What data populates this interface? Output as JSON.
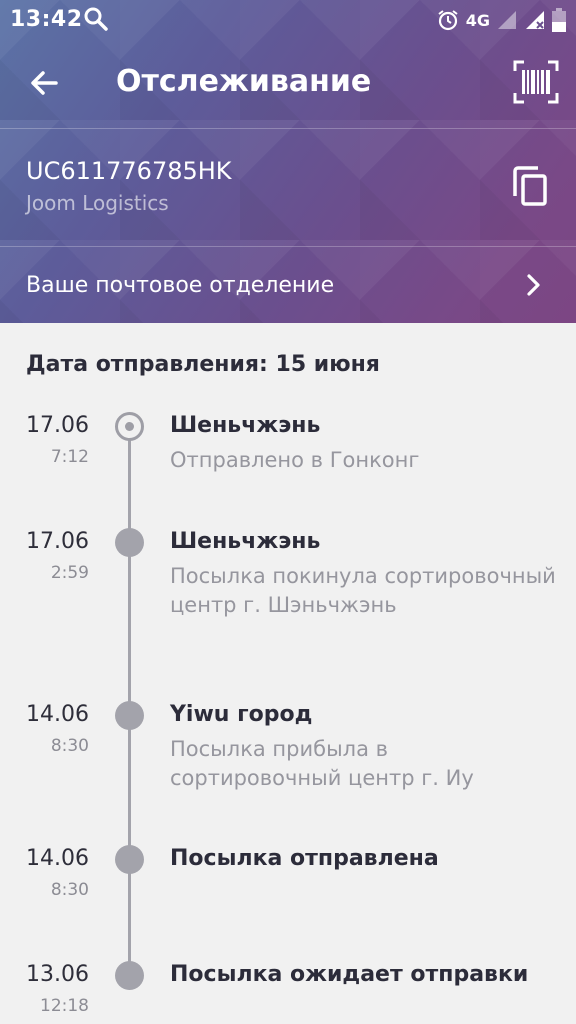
{
  "status_bar": {
    "time": "13:42",
    "network": "4G",
    "icons": [
      "search-icon",
      "alarm-icon",
      "signal-icon",
      "battery-icon"
    ]
  },
  "app_bar": {
    "title": "Отслеживание",
    "icons": [
      "back-arrow-icon",
      "barcode-scan-icon"
    ]
  },
  "parcel": {
    "tracking_number": "UC611776785HK",
    "carrier": "Joom Logistics",
    "copy_icon": "copy-icon"
  },
  "post_office": {
    "label": "Ваше почтовое отделение",
    "icon": "chevron-right-icon"
  },
  "shipment": {
    "date_title": "Дата отправления: 15 июня"
  },
  "colors": {
    "header_gradient_start": "#5b73a6",
    "header_gradient_end": "#7c4683",
    "background": "#f1f1f1",
    "timeline": "#a3a3ab"
  },
  "events": [
    {
      "date": "17.06",
      "time": "7:12",
      "place": "Шеньчжэнь",
      "desc": "Отправлено в Гонконг",
      "current": true
    },
    {
      "date": "17.06",
      "time": "2:59",
      "place": "Шеньчжэнь",
      "desc": "Посылка покинула сортировочный центр г. Шэньчжэнь",
      "current": false
    },
    {
      "date": "14.06",
      "time": "8:30",
      "place": "Yiwu город",
      "desc": "Посылка прибыла в сортировочный центр г. Иу",
      "current": false
    },
    {
      "date": "14.06",
      "time": "8:30",
      "place": "Посылка отправлена",
      "desc": "",
      "current": false
    },
    {
      "date": "13.06",
      "time": "12:18",
      "place": "Посылка ожидает отправки",
      "desc": "",
      "current": false
    }
  ]
}
